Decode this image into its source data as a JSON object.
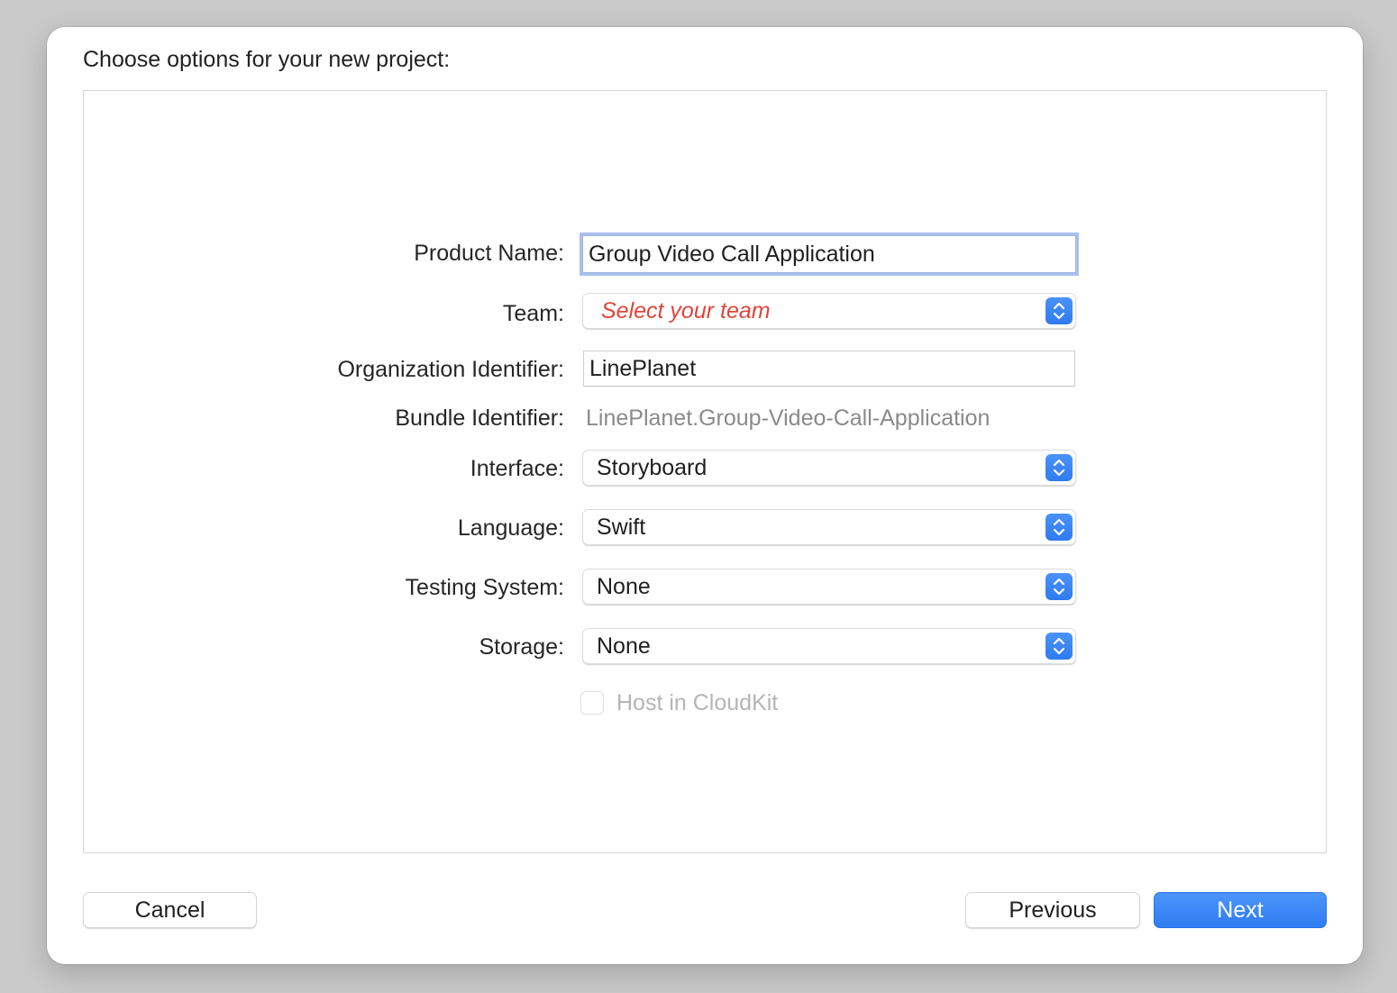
{
  "sheet": {
    "title": "Choose options for your new project:"
  },
  "form": {
    "product_name": {
      "label": "Product Name:",
      "value": "Group Video Call Application"
    },
    "team": {
      "label": "Team:",
      "selected": "Select your team"
    },
    "organization_identifier": {
      "label": "Organization Identifier:",
      "value": "LinePlanet"
    },
    "bundle_identifier": {
      "label": "Bundle Identifier:",
      "value": "LinePlanet.Group-Video-Call-Application"
    },
    "interface": {
      "label": "Interface:",
      "selected": "Storyboard"
    },
    "language": {
      "label": "Language:",
      "selected": "Swift"
    },
    "testing_system": {
      "label": "Testing System:",
      "selected": "None"
    },
    "storage": {
      "label": "Storage:",
      "selected": "None"
    },
    "host_in_cloudkit": {
      "label": "Host in CloudKit",
      "checked": false,
      "enabled": false
    }
  },
  "buttons": {
    "cancel": "Cancel",
    "previous": "Previous",
    "next": "Next"
  },
  "colors": {
    "accent": "#2f7cf2",
    "focus_ring": "#a8c1ee",
    "placeholder_red": "#e0453a",
    "secondary_text": "#8a8a8a",
    "disabled_text": "#b5b5b5"
  }
}
